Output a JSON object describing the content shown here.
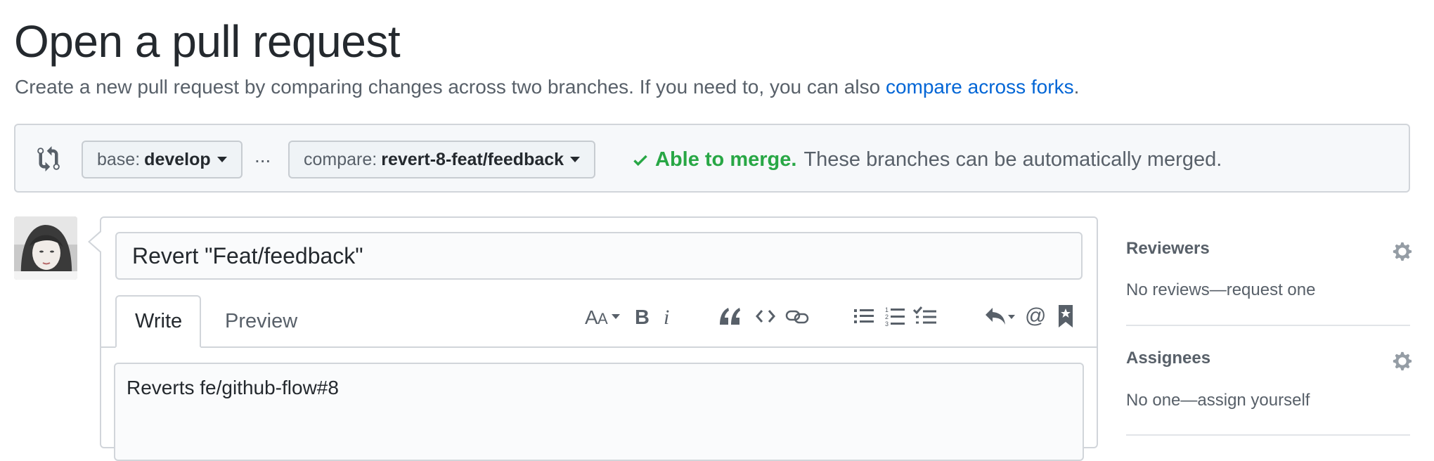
{
  "page": {
    "title": "Open a pull request",
    "subtitle_text": "Create a new pull request by comparing changes across two branches. If you need to, you can also ",
    "subtitle_link": "compare across forks",
    "subtitle_end": "."
  },
  "range": {
    "icon": "git-compare-icon",
    "base_label": "base:",
    "base_branch": "develop",
    "separator": "...",
    "compare_label": "compare:",
    "compare_branch": "revert-8-feat/feedback",
    "merge_status": "Able to merge.",
    "merge_message": "These branches can be automatically merged.",
    "merge_color": "#28a745"
  },
  "editor": {
    "title_value": "Revert \"Feat/feedback\"",
    "tabs": [
      {
        "label": "Write",
        "active": true
      },
      {
        "label": "Preview",
        "active": false
      }
    ],
    "toolbar": [
      "text-size-icon",
      "bold-icon",
      "italic-icon",
      "quote-icon",
      "code-icon",
      "link-icon",
      "bullet-list-icon",
      "numbered-list-icon",
      "task-list-icon",
      "reply-icon",
      "mention-icon",
      "saved-reply-icon"
    ],
    "body_value": "Reverts fe/github-flow#8"
  },
  "sidebar": {
    "reviewers": {
      "heading": "Reviewers",
      "text": "No reviews—request one"
    },
    "assignees": {
      "heading": "Assignees",
      "text": "No one—assign yourself"
    }
  }
}
